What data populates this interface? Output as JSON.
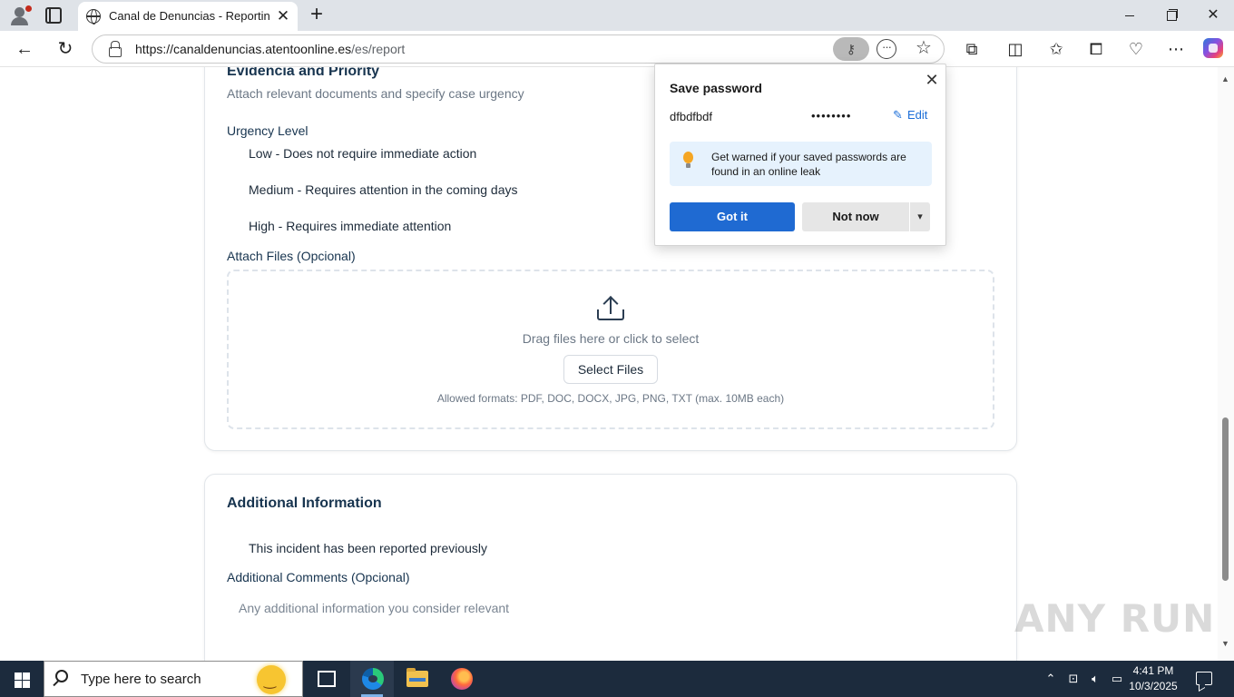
{
  "browser": {
    "tab_title": "Canal de Denuncias - Reporting C",
    "url_host": "https://canaldenuncias.atentoonline.es",
    "url_path": "/es/report",
    "new_tab_label": "+",
    "close_tab_label": "✕"
  },
  "page": {
    "evidence": {
      "title": "Evidencia and Priority",
      "subtitle": "Attach relevant documents and specify case urgency",
      "urgency_label": "Urgency Level",
      "urgency_options": [
        "Low - Does not require immediate action",
        "Medium - Requires attention in the coming days",
        "High - Requires immediate attention"
      ],
      "attach_label": "Attach Files (Opcional)",
      "drop_text": "Drag files here or click to select",
      "select_button": "Select Files",
      "formats_text": "Allowed formats: PDF, DOC, DOCX, JPG, PNG, TXT (max. 10MB each)"
    },
    "additional": {
      "title": "Additional Information",
      "reported_previously": "This incident has been reported previously",
      "comments_label": "Additional Comments (Opcional)",
      "comments_placeholder": "Any additional information you consider relevant"
    }
  },
  "password_popup": {
    "title": "Save password",
    "username": "dfbdfbdf",
    "password_mask": "••••••••",
    "edit_label": "Edit",
    "warning_text": "Get warned if your saved passwords are found in an online leak",
    "got_it_label": "Got it",
    "not_now_label": "Not now"
  },
  "taskbar": {
    "search_placeholder": "Type here to search",
    "time": "4:41 PM",
    "date": "10/3/2025"
  },
  "watermark": "ANY RUN",
  "colors": {
    "accent_blue": "#1f6ad2",
    "heading_navy": "#17344f",
    "taskbar_bg": "#1c2b3d"
  }
}
